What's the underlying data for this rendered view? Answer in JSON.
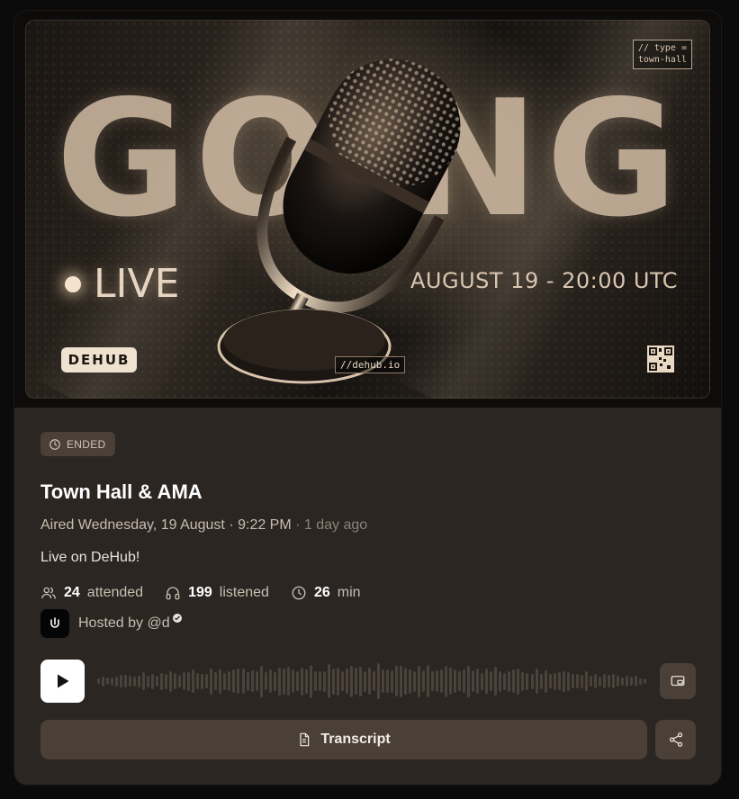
{
  "banner": {
    "big_word": "GOING",
    "live_text": "LIVE",
    "date_text": "AUGUST 19 - 20:00 UTC",
    "code_tag_line1": "// type =",
    "code_tag_line2": "town-hall",
    "brand_logo": "DEHUB",
    "url_tag": "//dehub.io"
  },
  "event": {
    "status_badge": "ENDED",
    "title": "Town Hall & AMA",
    "aired_text": "Aired Wednesday, 19 August · 9:22 PM",
    "relative_time": "· 1 day ago",
    "description": "Live on DeHub!",
    "stats": {
      "attended_count": "24",
      "attended_label": "attended",
      "listened_count": "199",
      "listened_label": "listened",
      "duration_value": "26",
      "duration_label": "min"
    },
    "host_text": "Hosted by @d"
  },
  "player": {
    "transcript_label": "Transcript"
  },
  "icons": {
    "badge": "clock-icon",
    "attended": "users-icon",
    "listened": "headphones-icon",
    "duration": "clock-icon",
    "play": "play-icon",
    "cast": "cast-icon",
    "transcript": "document-icon",
    "share": "share-icon"
  },
  "colors": {
    "card_bg": "#2b2622",
    "button_bg": "#4a4038",
    "accent_text": "#ffffff",
    "muted_text": "#c9bdb1"
  }
}
